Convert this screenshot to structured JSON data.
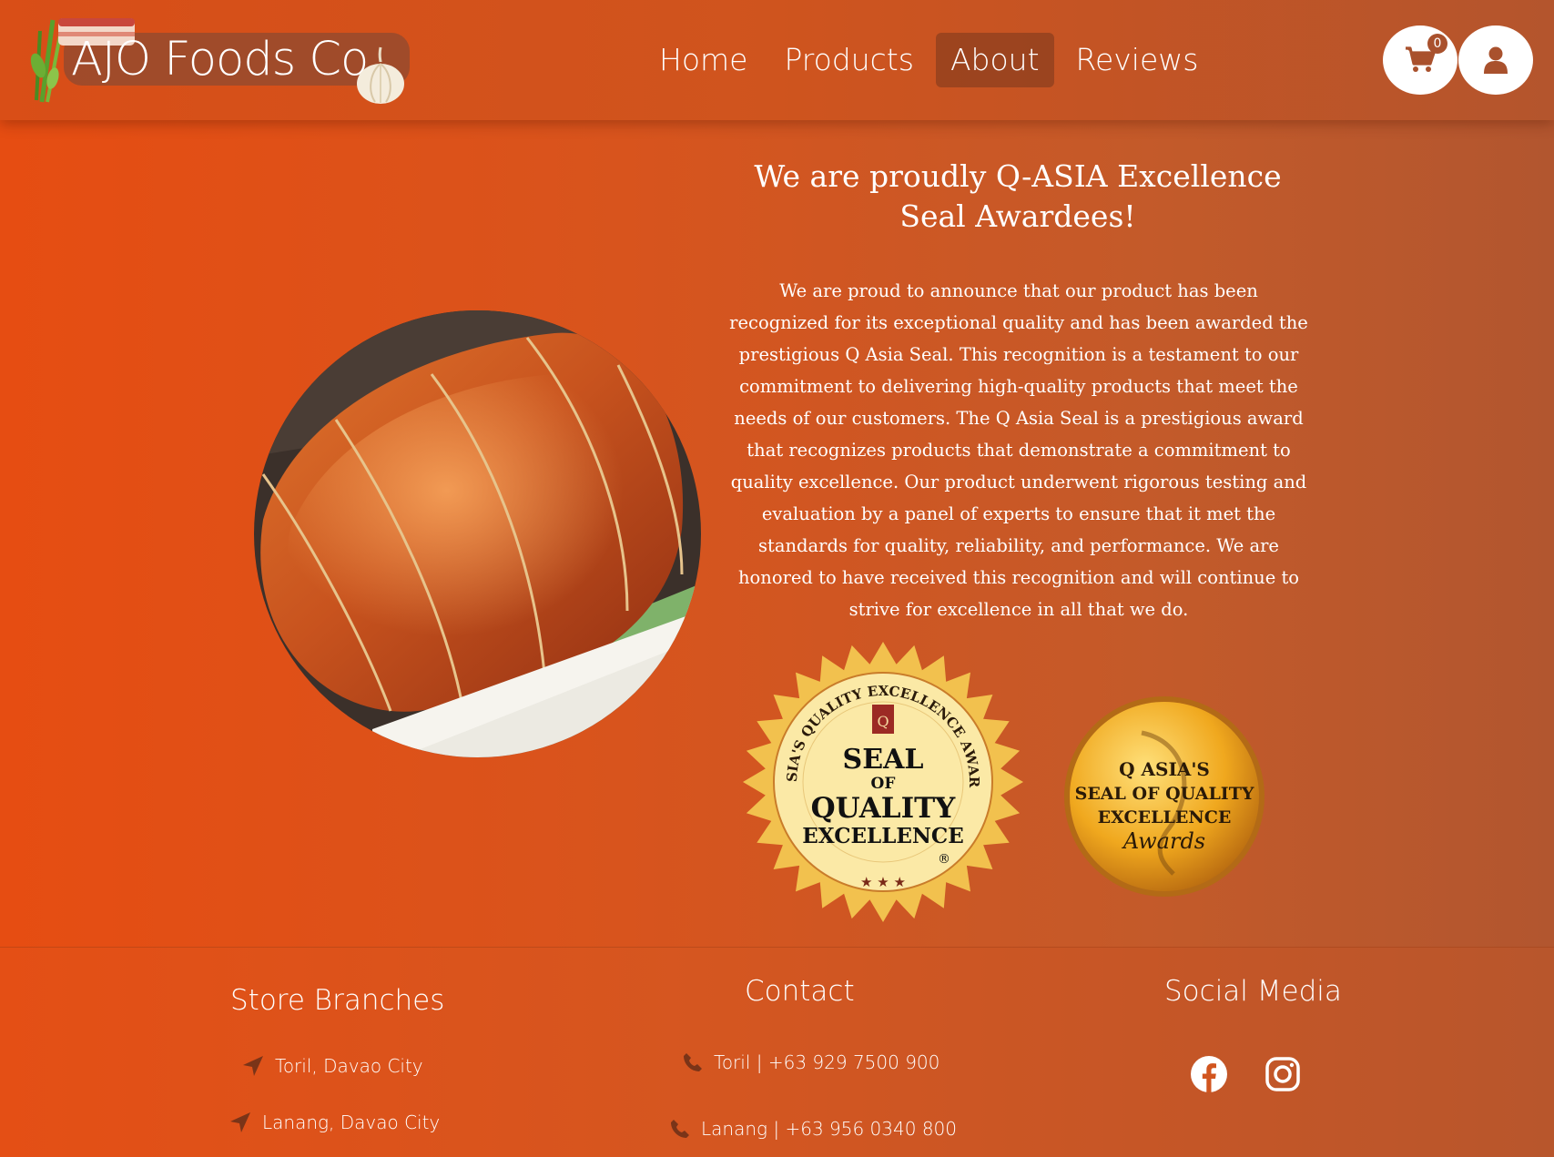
{
  "header": {
    "logo_text": "AJO Foods Co.",
    "nav": [
      {
        "label": "Home"
      },
      {
        "label": "Products"
      },
      {
        "label": "About"
      },
      {
        "label": "Reviews"
      }
    ],
    "active_nav": "About",
    "cart_count": "0",
    "cart_icon": "shopping-cart-icon",
    "user_icon": "user-icon"
  },
  "main": {
    "headline": "We are proudly Q-ASIA Excellence Seal Awardees!",
    "body": "We are proud to announce that our product has been recognized for its exceptional quality and has been awarded the prestigious Q Asia Seal. This recognition is a testament to our commitment to delivering high-quality products that meet the needs of our customers. The Q Asia Seal is a prestigious award that recognizes products that demonstrate a commitment to quality excellence. Our product underwent rigorous testing and evaluation by a panel of experts to ensure that it met the standards for quality, reliability, and performance. We are honored to have received this recognition and will continue to strive for excellence in all that we do.",
    "seal1": {
      "ring_text": "Q ASIA'S QUALITY EXCELLENCE AWARDS",
      "line1": "SEAL",
      "line2": "OF",
      "line3": "QUALITY",
      "line4": "EXCELLENCE",
      "reg": "®"
    },
    "seal2": {
      "line1": "Q ASIA'S",
      "line2": "SEAL OF QUALITY",
      "line3": "EXCELLENCE",
      "line4": "Awards"
    }
  },
  "footer": {
    "branches_heading": "Store Branches",
    "branches": [
      "Toril, Davao City",
      "Lanang, Davao City"
    ],
    "contact_heading": "Contact",
    "contacts": [
      "Toril | +63 929 7500 900",
      "Lanang | +63 956 0340 800"
    ],
    "social_heading": "Social Media",
    "social": [
      "facebook-icon",
      "instagram-icon"
    ]
  },
  "colors": {
    "primary": "#e04f16",
    "header_dark": "#b4552d",
    "active_nav_bg": "#8a4428",
    "seal_gold": "#f2c14e"
  }
}
